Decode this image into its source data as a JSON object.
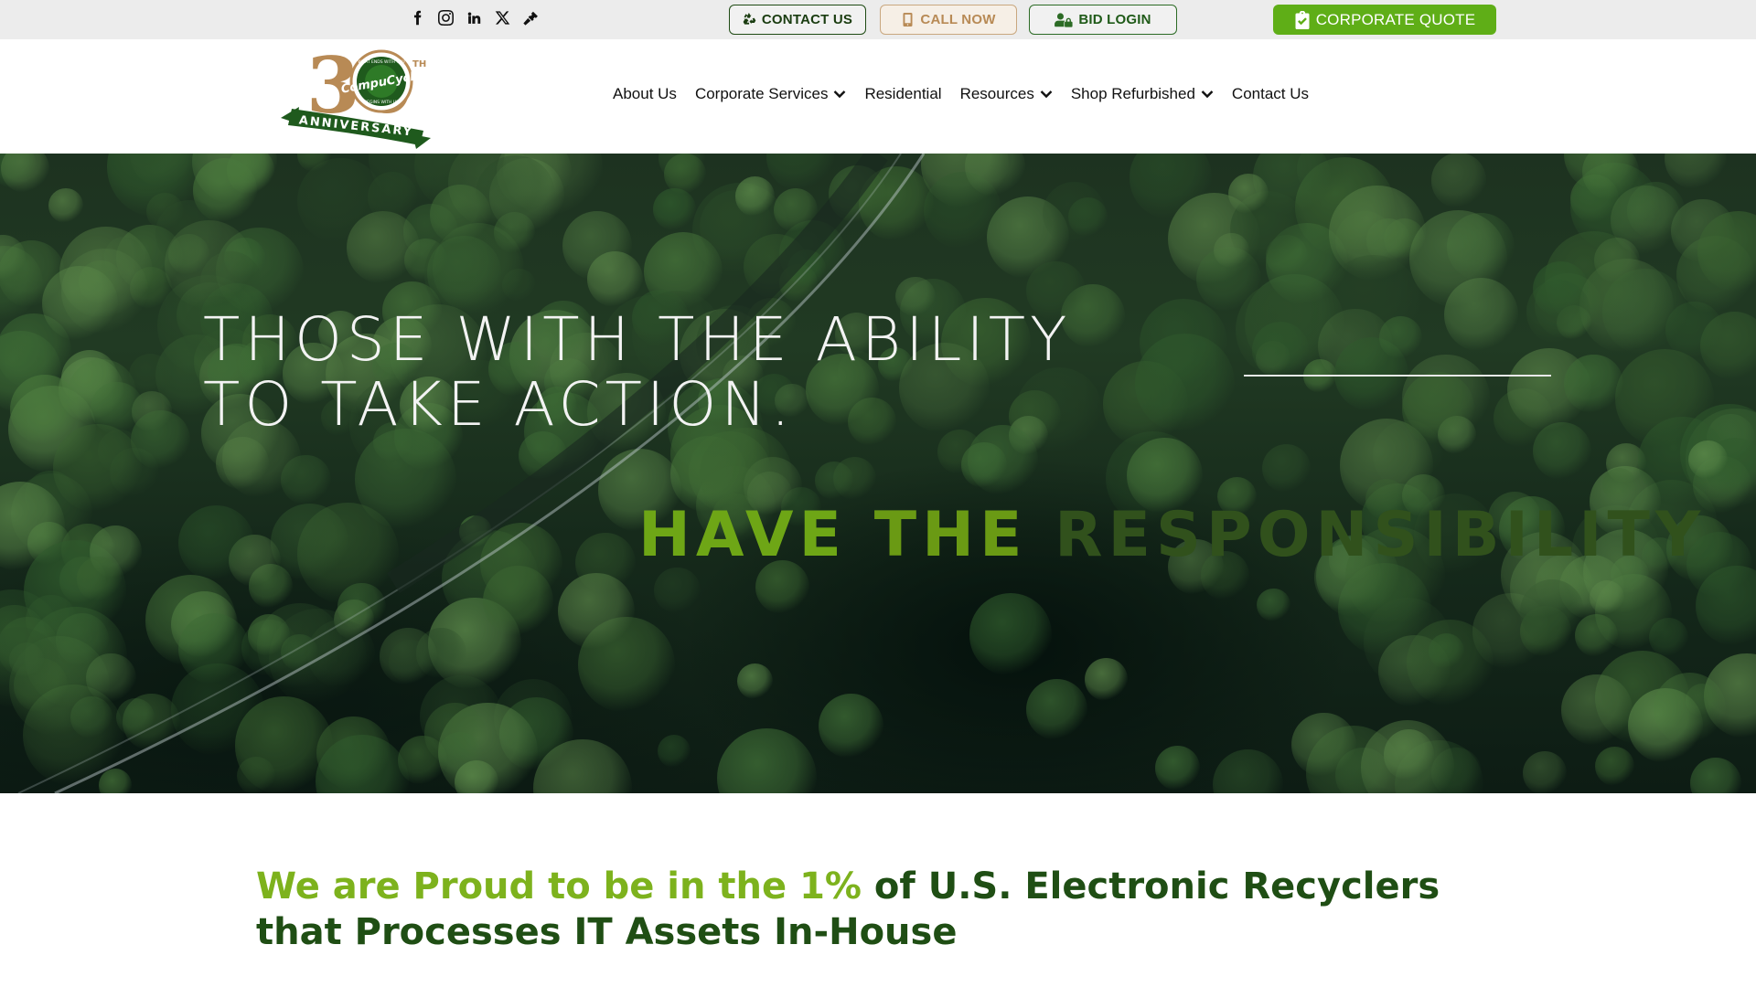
{
  "topbar": {
    "social": [
      {
        "name": "facebook-icon"
      },
      {
        "name": "instagram-icon"
      },
      {
        "name": "linkedin-icon"
      },
      {
        "name": "x-twitter-icon"
      },
      {
        "name": "auction-gavel-icon"
      }
    ],
    "contact_label": "CONTACT US",
    "call_label": "CALL NOW",
    "bid_label": "BID LOGIN",
    "quote_label": "CORPORATE QUOTE"
  },
  "logo": {
    "number": "30",
    "superscript": "TH",
    "brand": "CompuCycle",
    "ring_top": "WHAT ENDS WITH YOU",
    "ring_bottom": "BEGINS WITH US",
    "ribbon": "ANNIVERSARY"
  },
  "nav": [
    {
      "label": "About Us",
      "dropdown": false
    },
    {
      "label": "Corporate Services",
      "dropdown": true
    },
    {
      "label": "Residential",
      "dropdown": false
    },
    {
      "label": "Resources",
      "dropdown": true
    },
    {
      "label": "Shop Refurbished",
      "dropdown": true
    },
    {
      "label": "Contact Us",
      "dropdown": false
    }
  ],
  "hero": {
    "line1": "THOSE WITH THE ABILITY",
    "line2": "TO TAKE ACTION.",
    "tag_word1": "HAVE",
    "tag_word2": "THE",
    "tag_word3": "RESPONSIBILITY"
  },
  "content": {
    "headline_accent": "We are Proud to be in the 1%",
    "headline_rest": " of U.S. Electronic Recyclers that Processes IT Assets In-House"
  },
  "colors": {
    "brand_green": "#5fae17",
    "dark_green": "#1f4e14",
    "accent_green": "#7db21d",
    "gold": "#b88a55"
  }
}
